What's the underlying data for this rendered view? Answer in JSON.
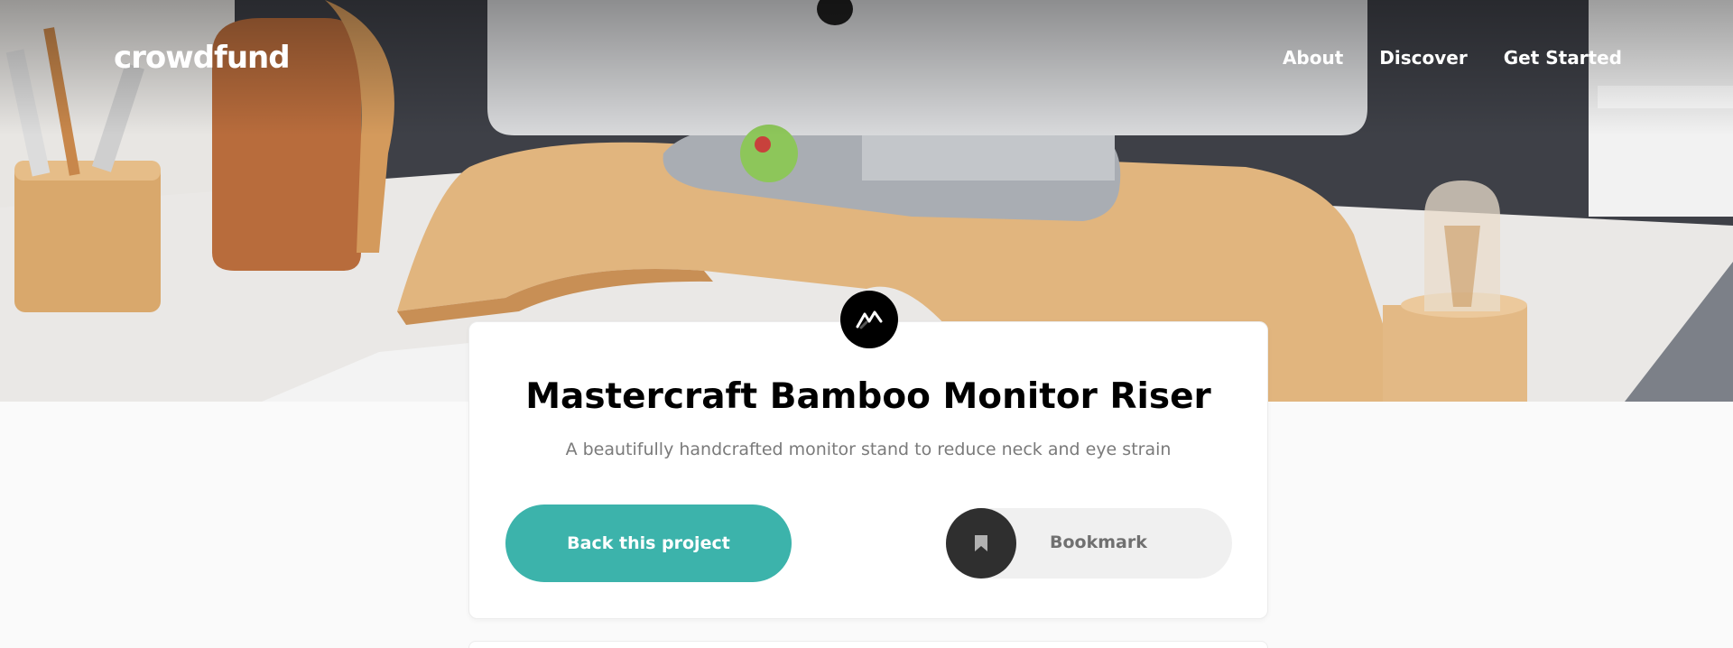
{
  "header": {
    "logo": "crowdfund",
    "nav": [
      {
        "label": "About"
      },
      {
        "label": "Discover"
      },
      {
        "label": "Get Started"
      }
    ]
  },
  "project": {
    "logo_icon": "mastercraft-logo-icon",
    "title": "Mastercraft Bamboo Monitor Riser",
    "subtitle": "A beautifully handcrafted monitor stand to reduce neck and eye strain",
    "back_label": "Back this project",
    "bookmark_label": "Bookmark",
    "bookmark_icon": "bookmark-icon"
  },
  "colors": {
    "accent": "#3cb3ab",
    "dark": "#2f2f2f",
    "bookmark_bg": "#f0f0f0"
  }
}
